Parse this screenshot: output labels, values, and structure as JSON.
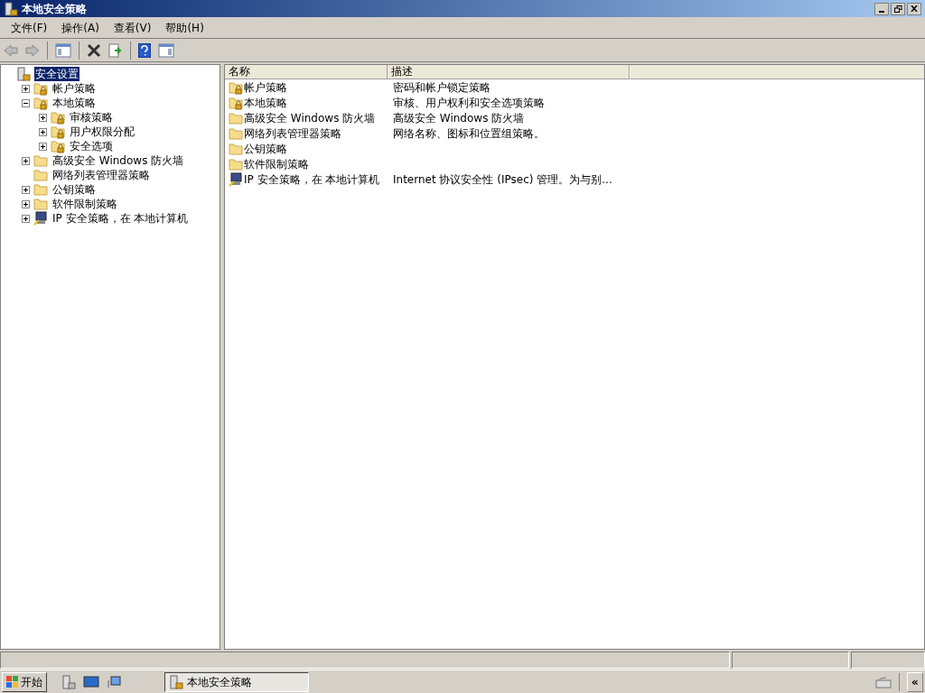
{
  "window": {
    "title": "本地安全策略"
  },
  "menu": [
    "文件(F)",
    "操作(A)",
    "查看(V)",
    "帮助(H)"
  ],
  "tree": [
    {
      "label": "安全设置",
      "kind": "root",
      "selected": true,
      "children": [
        {
          "label": "帐户策略",
          "kind": "lock-folder",
          "selected": false,
          "expanded": false
        },
        {
          "label": "本地策略",
          "kind": "lock-folder",
          "selected": false,
          "expanded": true,
          "children": [
            {
              "label": "审核策略",
              "kind": "lock-folder",
              "selected": false,
              "expanded": false
            },
            {
              "label": "用户权限分配",
              "kind": "lock-folder",
              "selected": false,
              "expanded": false
            },
            {
              "label": "安全选项",
              "kind": "lock-folder",
              "selected": false,
              "expanded": false
            }
          ]
        },
        {
          "label": "高级安全 Windows 防火墙",
          "kind": "folder",
          "selected": false,
          "expanded": false
        },
        {
          "label": "网络列表管理器策略",
          "kind": "folder",
          "selected": false
        },
        {
          "label": "公钥策略",
          "kind": "folder",
          "selected": false,
          "expanded": false
        },
        {
          "label": "软件限制策略",
          "kind": "folder",
          "selected": false,
          "expanded": false
        },
        {
          "label": "IP 安全策略，在 本地计算机",
          "kind": "ipsec",
          "selected": false,
          "expanded": false
        }
      ]
    }
  ],
  "list": {
    "columns": [
      "名称",
      "描述"
    ],
    "rows": [
      {
        "name": "帐户策略",
        "description": "密码和帐户锁定策略",
        "kind": "lock-folder"
      },
      {
        "name": "本地策略",
        "description": "审核、用户权利和安全选项策略",
        "kind": "lock-folder"
      },
      {
        "name": "高级安全 Windows 防火墙",
        "description": "高级安全 Windows 防火墙",
        "kind": "folder"
      },
      {
        "name": "网络列表管理器策略",
        "description": "网络名称、图标和位置组策略。",
        "kind": "folder"
      },
      {
        "name": "公钥策略",
        "kind": "folder"
      },
      {
        "name": "软件限制策略",
        "kind": "folder"
      },
      {
        "name": "IP 安全策略，在 本地计算机",
        "description": "Internet 协议安全性 (IPsec) 管理。为与别...",
        "kind": "ipsec"
      }
    ]
  },
  "taskbar": {
    "start": "开始",
    "task": "本地安全策略",
    "expand": "«"
  }
}
